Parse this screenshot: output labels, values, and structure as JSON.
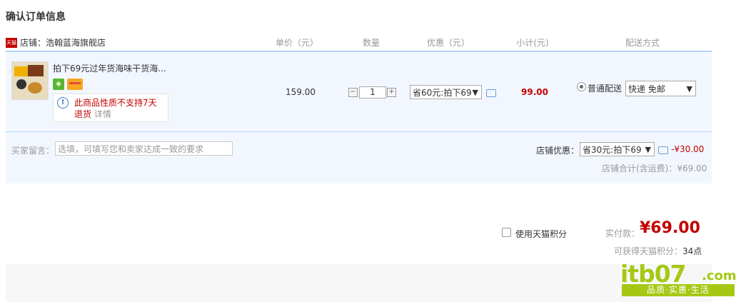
{
  "page": {
    "title": "确认订单信息"
  },
  "table": {
    "shop_icon_text": "天猫",
    "shop_label": "店铺：浩翰蓝海旗舰店",
    "headers": {
      "unit_price": "单价（元）",
      "quantity": "数量",
      "discount": "优惠（元）",
      "subtotal": "小计(元)",
      "shipping": "配送方式"
    }
  },
  "item": {
    "name": "拍下69元过年货海味干货海...",
    "badge1_icon": "trust-badge",
    "badge2_icon": "card-badge",
    "warning_icon": "!",
    "warning_text": "此商品性质不支持7天退货",
    "warning_detail": "详情",
    "price": "159.00",
    "qty_minus": "−",
    "quantity": "1",
    "qty_plus": "+",
    "promo_selected": "省60元:拍下69",
    "subtotal": "99.00",
    "shipping_method": "普通配送",
    "shipping_selected": "快递 免邮"
  },
  "footer": {
    "note_label": "买家留言：",
    "note_placeholder": "选填，可填写您和卖家达成一致的要求",
    "shop_discount_label": "店铺优惠：",
    "shop_discount_selected": "省30元:拍下69",
    "shop_discount_amount": "-¥30.00",
    "shop_total": "店铺合计(含运费)：¥69.00"
  },
  "summary": {
    "points_label": "使用天猫积分",
    "pay_label": "实付款：",
    "pay_amount": "¥69.00",
    "earn_label": "可获得天猫积分：",
    "earn_value": "34点"
  },
  "watermark": {
    "logo": "itb07",
    "com": ".com",
    "slogan": "品质·实惠·生活"
  },
  "colors": {
    "accent_red": "#c40000",
    "header_line": "#b2d1ff",
    "row_bg": "#f2f7ff",
    "watermark_green": "#a6c814"
  }
}
